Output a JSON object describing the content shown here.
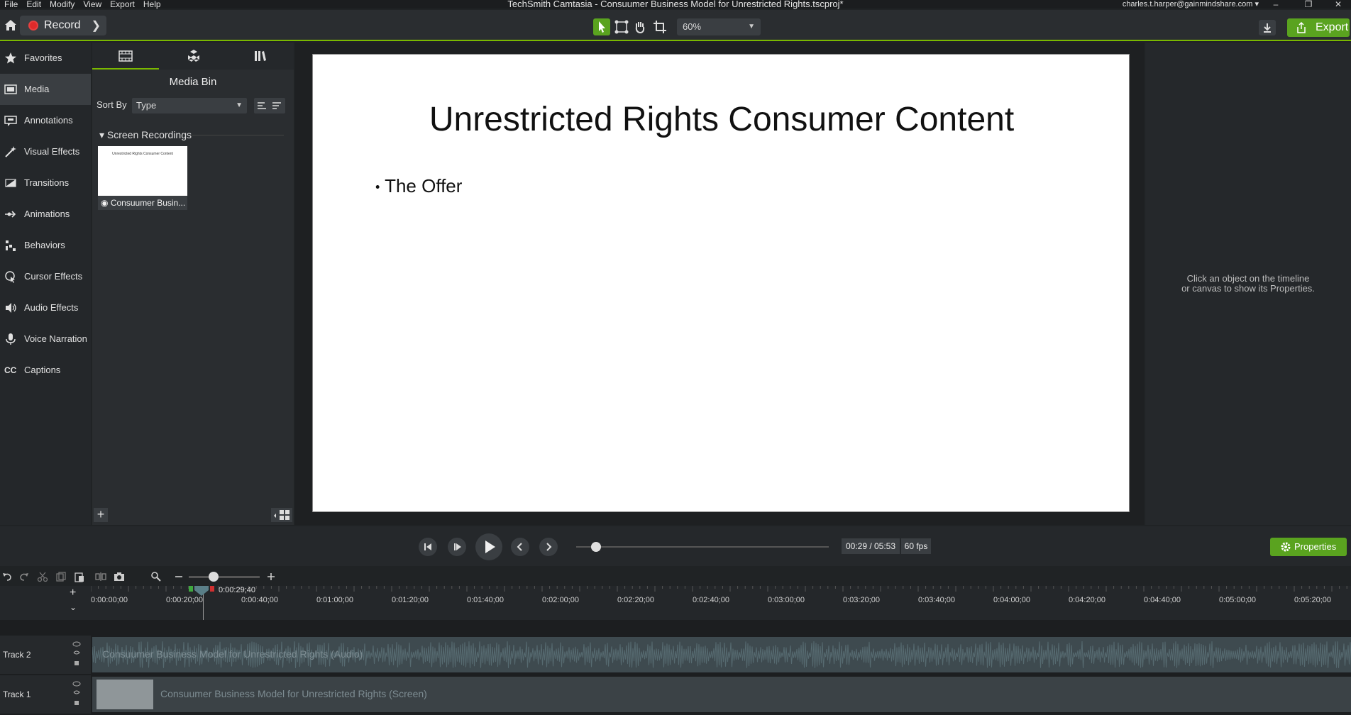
{
  "window": {
    "title": "TechSmith Camtasia - Consuumer Business Model for Unrestricted Rights.tscproj*",
    "menu": [
      "File",
      "Edit",
      "Modify",
      "View",
      "Export",
      "Help"
    ],
    "user": "charles.t.harper@gainmindshare.com"
  },
  "toolbar": {
    "record_label": "Record",
    "zoom": "60%",
    "export_label": "Export"
  },
  "nav": {
    "items": [
      "Favorites",
      "Media",
      "Annotations",
      "Visual Effects",
      "Transitions",
      "Animations",
      "Behaviors",
      "Cursor Effects",
      "Audio Effects",
      "Voice Narration",
      "Captions"
    ],
    "active": "Media"
  },
  "media": {
    "title": "Media Bin",
    "sort_label": "Sort By",
    "sort_value": "Type",
    "group": "Screen Recordings",
    "item_caption": "Consuumer Busin...",
    "thumb_text": "Unrestricted Rights Consumer Content"
  },
  "slide": {
    "title": "Unrestricted Rights Consumer Content",
    "bullet": "The Offer"
  },
  "properties": {
    "hint_line1": "Click an object on the timeline",
    "hint_line2": "or canvas to show its Properties.",
    "button": "Properties"
  },
  "playback": {
    "time": "00:29 / 05:53",
    "fps": "60 fps",
    "progress": 0.08
  },
  "timeline": {
    "playhead_time": "0:00:29;40",
    "ticks": [
      "0:00:00;00",
      "0:00:20;00",
      "0:00:40;00",
      "0:01:00;00",
      "0:01:20;00",
      "0:01:40;00",
      "0:02:00;00",
      "0:02:20;00",
      "0:02:40;00",
      "0:03:00;00",
      "0:03:20;00",
      "0:03:40;00",
      "0:04:00;00",
      "0:04:20;00",
      "0:04:40;00",
      "0:05:00;00",
      "0:05:20;00"
    ],
    "tracks": [
      {
        "name": "Track 2",
        "clip": "Consuumer Business Model for Unrestricted Rights (Audio)"
      },
      {
        "name": "Track 1",
        "clip": "Consuumer Business Model for Unrestricted Rights (Screen)"
      }
    ]
  },
  "colors": {
    "accent": "#7ab800",
    "button_green": "#5aa31f",
    "record_red": "#e02a2a"
  }
}
